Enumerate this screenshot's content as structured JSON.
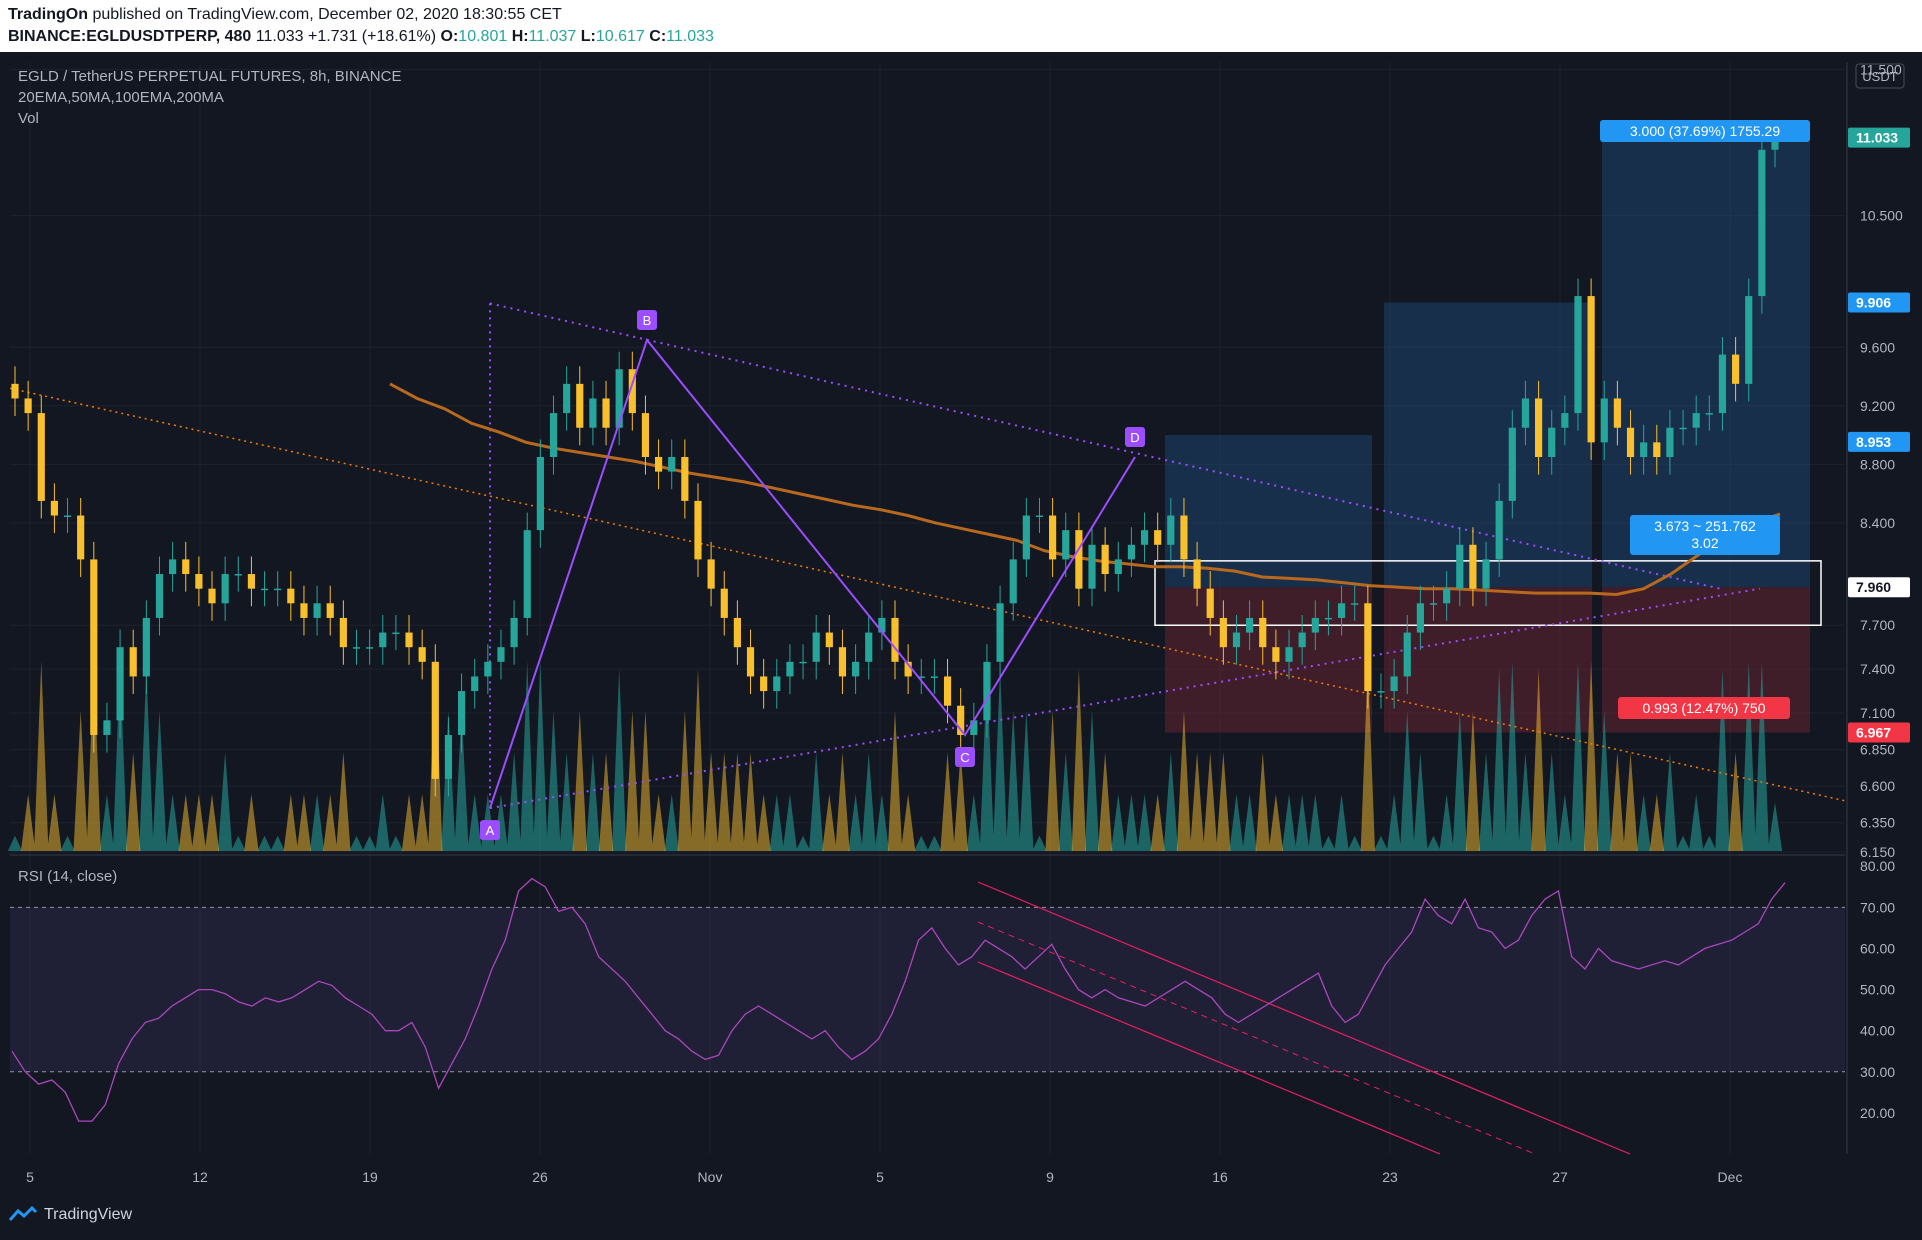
{
  "header": {
    "publisher": "TradingOn",
    "published_text": "published on TradingView.com, December 02, 2020 18:30:55 CET",
    "symbol": "BINANCE:EGLDUSDTPERP, 480",
    "last": "11.033",
    "change": "+1.731 (+18.61%)",
    "open_label": "O:",
    "open": "10.801",
    "high_label": "H:",
    "high": "11.037",
    "low_label": "L:",
    "low": "10.617",
    "close_label": "C:",
    "close": "11.033"
  },
  "legend": {
    "title": "EGLD / TetherUS PERPETUAL FUTURES, 8h, BINANCE",
    "indicators": "20EMA,50MA,100EMA,200MA",
    "volume": "Vol"
  },
  "rsi": {
    "label": "RSI (14, close)"
  },
  "footer": {
    "brand": "TradingView"
  },
  "chart_data": [
    {
      "type": "candlestick",
      "currency": "USDT",
      "ylim": [
        6.15,
        11.55
      ],
      "y_ticks": [
        "11.500",
        "10.500",
        "9.600",
        "9.200",
        "8.800",
        "8.400",
        "7.700",
        "7.400",
        "7.100",
        "6.850",
        "6.600",
        "6.350",
        "6.150"
      ],
      "x_ticks": [
        "5",
        "12",
        "19",
        "26",
        "Nov",
        "5",
        "9",
        "16",
        "23",
        "27",
        "Dec"
      ],
      "price_markers": [
        {
          "label": "11.033",
          "color": "#26a69a"
        },
        {
          "label": "9.906",
          "color": "#2196f3"
        },
        {
          "label": "8.953",
          "color": "#2196f3"
        },
        {
          "label": "7.960",
          "color": "#ffffff"
        },
        {
          "label": "6.967",
          "color": "#f23645"
        }
      ],
      "pattern_points": [
        "A",
        "B",
        "C",
        "D"
      ],
      "pattern_values": [
        6.45,
        9.65,
        6.95,
        8.85
      ],
      "position_labels": {
        "target": "3.000 (37.69%) 1755.29",
        "stop": "0.993 (12.47%) 750",
        "ratio_line1": "3.673 ~ 251.762",
        "ratio_line2": "3.02"
      },
      "series_colors": {
        "up": "#26a69a",
        "down": "#f9c02d",
        "ma100": "#b8691e",
        "pattern": "#9c4dff",
        "trend": "#f57c00"
      },
      "closes": [
        9.25,
        9.15,
        8.55,
        8.45,
        8.45,
        8.15,
        6.95,
        7.05,
        7.55,
        7.35,
        7.75,
        8.05,
        8.15,
        8.05,
        7.95,
        7.85,
        8.05,
        8.05,
        7.95,
        7.95,
        7.95,
        7.85,
        7.75,
        7.85,
        7.75,
        7.55,
        7.55,
        7.55,
        7.65,
        7.65,
        7.55,
        7.45,
        6.65,
        6.95,
        7.25,
        7.35,
        7.45,
        7.55,
        7.75,
        8.35,
        8.85,
        9.15,
        9.35,
        9.05,
        9.25,
        9.05,
        9.45,
        9.15,
        8.85,
        8.75,
        8.85,
        8.55,
        8.15,
        7.95,
        7.75,
        7.55,
        7.35,
        7.25,
        7.35,
        7.45,
        7.45,
        7.65,
        7.55,
        7.35,
        7.45,
        7.65,
        7.75,
        7.45,
        7.35,
        7.35,
        7.35,
        7.15,
        6.95,
        7.05,
        7.45,
        7.85,
        8.15,
        8.45,
        8.45,
        8.15,
        8.35,
        7.95,
        8.25,
        8.05,
        8.15,
        8.25,
        8.35,
        8.25,
        8.45,
        8.15,
        7.95,
        7.75,
        7.55,
        7.65,
        7.75,
        7.55,
        7.45,
        7.55,
        7.65,
        7.75,
        7.75,
        7.85,
        7.85,
        7.25,
        7.25,
        7.35,
        7.65,
        7.85,
        7.85,
        7.95,
        8.25,
        7.95,
        8.15,
        8.55,
        9.05,
        9.25,
        8.85,
        9.05,
        9.15,
        9.95,
        8.95,
        9.25,
        9.05,
        8.85,
        8.95,
        8.85,
        9.05,
        9.05,
        9.15,
        9.15,
        9.55,
        9.35,
        9.95,
        10.95,
        11.03
      ],
      "ma100": [
        9.35,
        9.25,
        9.18,
        9.08,
        9.02,
        8.95,
        8.91,
        8.88,
        8.85,
        8.82,
        8.78,
        8.74,
        8.71,
        8.68,
        8.64,
        8.6,
        8.56,
        8.52,
        8.49,
        8.45,
        8.4,
        8.36,
        8.32,
        8.28,
        8.21,
        8.17,
        8.14,
        8.12,
        8.1,
        8.1,
        8.09,
        8.07,
        8.03,
        8.02,
        8.01,
        7.99,
        7.97,
        7.96,
        7.95,
        7.95,
        7.94,
        7.93,
        7.92,
        7.92,
        7.92,
        7.91,
        7.95,
        8.05,
        8.18,
        8.3,
        8.4,
        8.46
      ]
    },
    {
      "type": "line",
      "name": "RSI",
      "ylim": [
        10,
        82
      ],
      "y_ticks": [
        "80.00",
        "70.00",
        "60.00",
        "50.00",
        "40.00",
        "30.00",
        "20.00"
      ],
      "bands": [
        30,
        70
      ],
      "values": [
        35,
        30,
        27,
        28,
        25,
        18,
        18,
        22,
        32,
        38,
        42,
        43,
        46,
        48,
        50,
        50,
        49,
        47,
        46,
        48,
        47,
        48,
        50,
        52,
        51,
        48,
        46,
        44,
        40,
        40,
        42,
        36,
        26,
        32,
        38,
        46,
        55,
        62,
        74,
        77,
        75,
        69,
        70,
        66,
        58,
        55,
        52,
        48,
        44,
        40,
        38,
        35,
        33,
        34,
        40,
        44,
        46,
        44,
        42,
        40,
        38,
        40,
        36,
        33,
        35,
        38,
        44,
        52,
        62,
        65,
        60,
        56,
        58,
        62,
        60,
        58,
        55,
        58,
        61,
        55,
        50,
        48,
        50,
        48,
        47,
        46,
        48,
        50,
        52,
        50,
        48,
        44,
        42,
        44,
        46,
        48,
        50,
        52,
        54,
        46,
        42,
        44,
        50,
        56,
        60,
        64,
        72,
        68,
        66,
        72,
        65,
        64,
        60,
        62,
        68,
        72,
        74,
        58,
        55,
        60,
        57,
        56,
        55,
        56,
        57,
        56,
        58,
        60,
        61,
        62,
        64,
        66,
        72,
        76
      ]
    }
  ]
}
